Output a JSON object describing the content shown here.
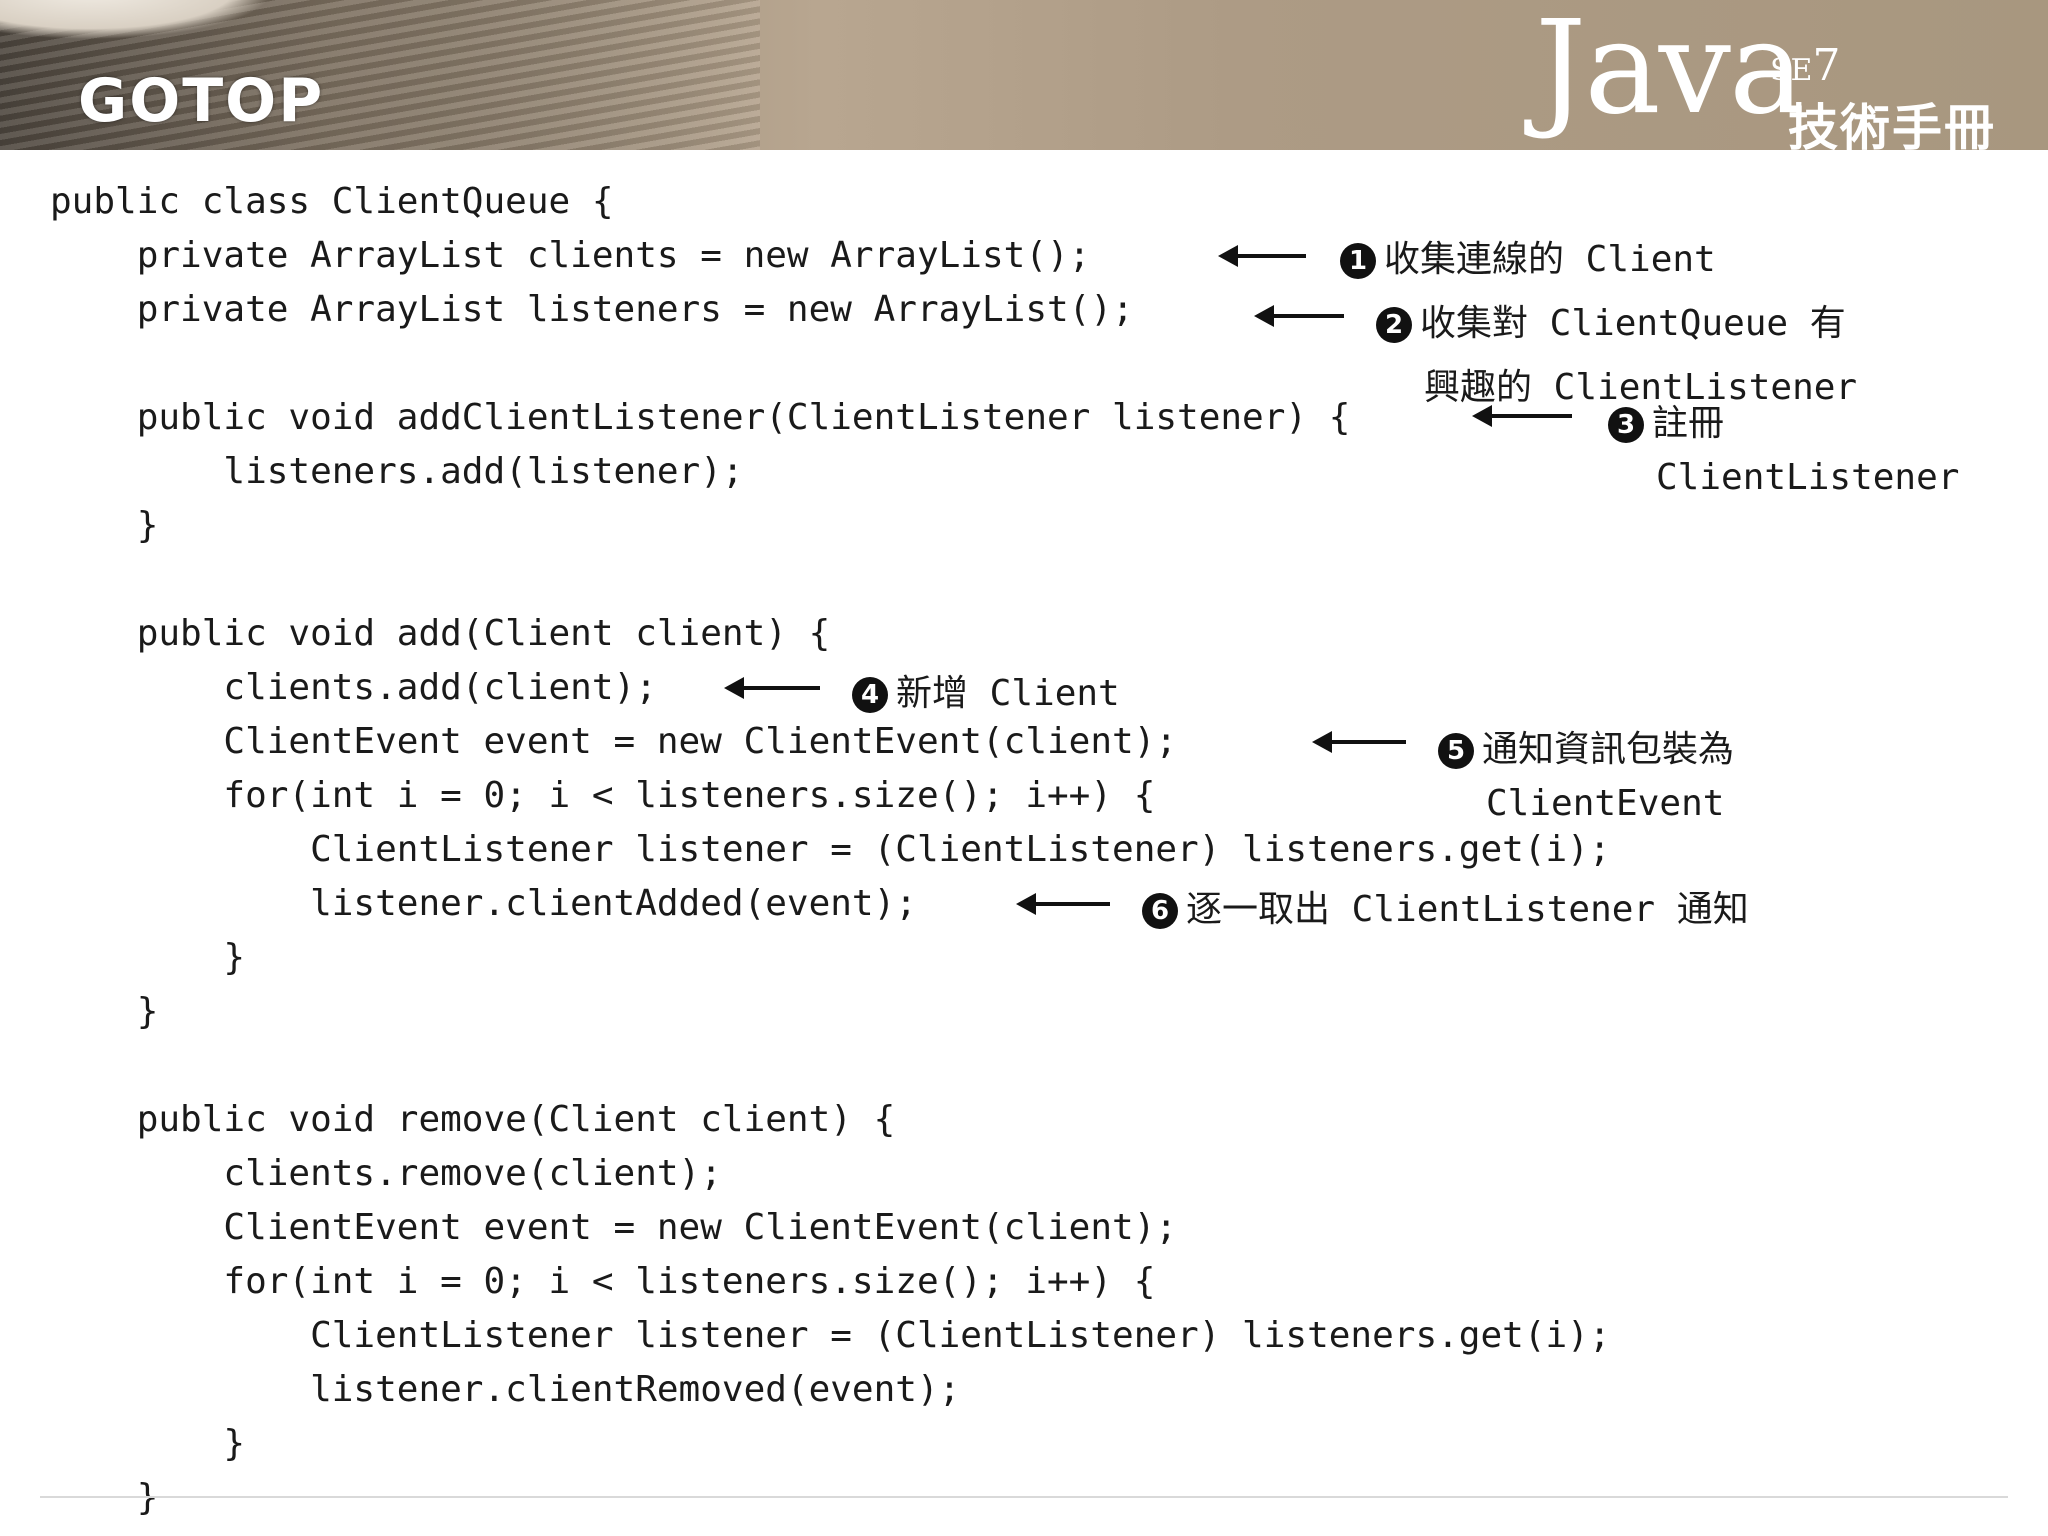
{
  "header": {
    "logo": "GOTOP",
    "java": "Java",
    "se": "SE",
    "version": "7",
    "book": "技術手冊"
  },
  "code": [
    "public class ClientQueue {",
    "    private ArrayList clients = new ArrayList();",
    "    private ArrayList listeners = new ArrayList();",
    "",
    "    public void addClientListener(ClientListener listener) {",
    "        listeners.add(listener);",
    "    }",
    "",
    "",
    "    public void add(Client client) {",
    "        clients.add(client);",
    "        ClientEvent event = new ClientEvent(client);",
    "        for(int i = 0; i < listeners.size(); i++) {",
    "            ClientListener listener = (ClientListener) listeners.get(i);",
    "            listener.clientAdded(event);",
    "        }",
    "    }",
    "",
    "",
    "    public void remove(Client client) {",
    "        clients.remove(client);",
    "        ClientEvent event = new ClientEvent(client);",
    "        for(int i = 0; i < listeners.size(); i++) {",
    "            ClientListener listener = (ClientListener) listeners.get(i);",
    "            listener.clientRemoved(event);",
    "        }",
    "    }"
  ],
  "annotations": [
    {
      "num": "1",
      "lines": [
        "收集連線的 Client"
      ]
    },
    {
      "num": "2",
      "lines": [
        "收集對 ClientQueue 有",
        "興趣的 ClientListener"
      ]
    },
    {
      "num": "3",
      "lines": [
        "註冊",
        "ClientListener"
      ]
    },
    {
      "num": "4",
      "lines": [
        "新增 Client"
      ]
    },
    {
      "num": "5",
      "lines": [
        "通知資訊包裝為",
        "ClientEvent"
      ]
    },
    {
      "num": "6",
      "lines": [
        "逐一取出 ClientListener 通知"
      ]
    }
  ]
}
